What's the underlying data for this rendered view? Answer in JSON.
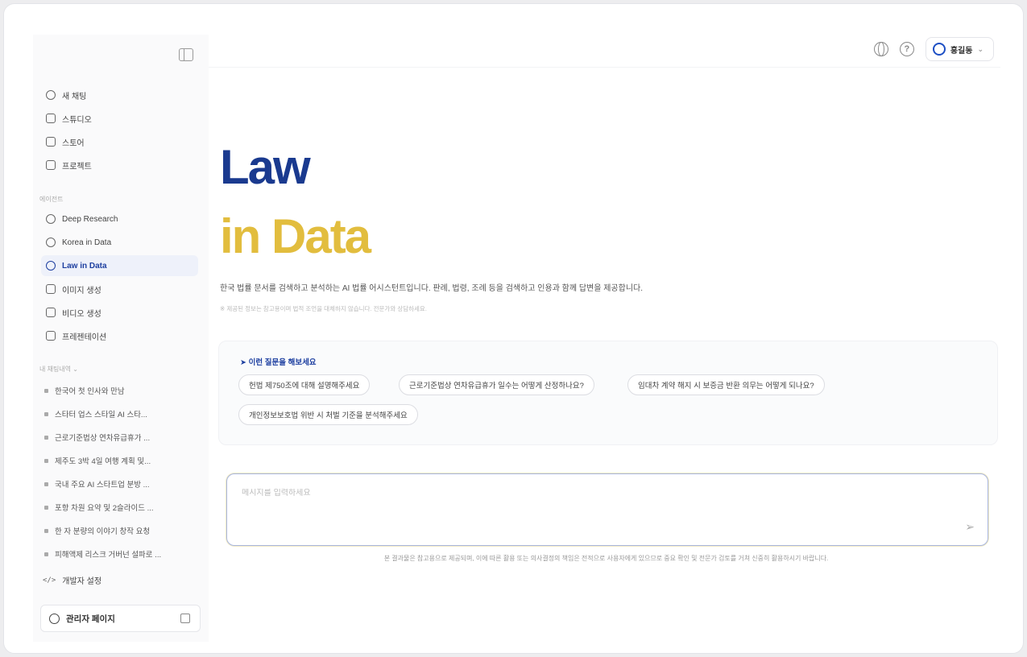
{
  "sidebar": {
    "nav": [
      {
        "label": "새 채팅",
        "icon": "chat-plus-icon"
      },
      {
        "label": "스튜디오",
        "icon": "studio-icon"
      },
      {
        "label": "스토어",
        "icon": "store-icon"
      },
      {
        "label": "프로젝트",
        "icon": "folder-icon"
      }
    ],
    "section_label": "에이전트",
    "agents": [
      {
        "label": "Deep Research",
        "icon": "research-icon"
      },
      {
        "label": "Korea in Data",
        "icon": "globe-search-icon"
      },
      {
        "label": "Law in Data",
        "icon": "law-icon",
        "active": true
      },
      {
        "label": "이미지 생성",
        "icon": "image-icon"
      },
      {
        "label": "비디오 생성",
        "icon": "video-icon"
      },
      {
        "label": "프레젠테이션",
        "icon": "presentation-icon"
      }
    ],
    "history_label": "내 채팅내역 ⌄",
    "history": [
      "한국어 첫 인사와 만남",
      "스타터 업스 스타일 AI 스타...",
      "근로기준법상 연차유급휴가 ...",
      "제주도 3박 4일 여행 계획 및...",
      "국내 주요 AI 스타트업 분방 ...",
      "포항 차원 요약 및 2슬라이드 ...",
      "한 자 분량의 이야기 창작 요청",
      "피해액제 리스크 거버넌 설파로 ..."
    ],
    "dev_label": "개발자 설정",
    "admin_label": "관리자 페이지"
  },
  "header": {
    "user_name": "홍길동"
  },
  "hero": {
    "title_line1": "Law",
    "title_line2": "in Data",
    "description": "한국 법률 문서를 검색하고 분석하는 AI 법률 어시스턴트입니다. 판례, 법령, 조례 등을 검색하고 인용과 함께 답변을 제공합니다.",
    "note": "※ 제공된 정보는 참고용이며 법적 조언을 대체하지 않습니다. 전문가와 상담하세요."
  },
  "suggestions": {
    "heading": "이런 질문을 해보세요",
    "chips": [
      "헌법 제750조에 대해 설명해주세요",
      "근로기준법상 연차유급휴가 일수는 어떻게 산정하나요?",
      "임대차 계약 해지 시 보증금 반환 의무는 어떻게 되나요?",
      "개인정보보호법 위반 시 처벌 기준을 분석해주세요"
    ]
  },
  "chat": {
    "placeholder": "메시지를 입력하세요"
  },
  "disclaimer": "본 결과물은 참고용으로 제공되며, 이에 따른 활용 또는 의사결정의 책임은 전적으로 사용자에게 있으므로 중요 확인 및 전문가 검토를 거쳐 신중히 활용하시기 바랍니다."
}
